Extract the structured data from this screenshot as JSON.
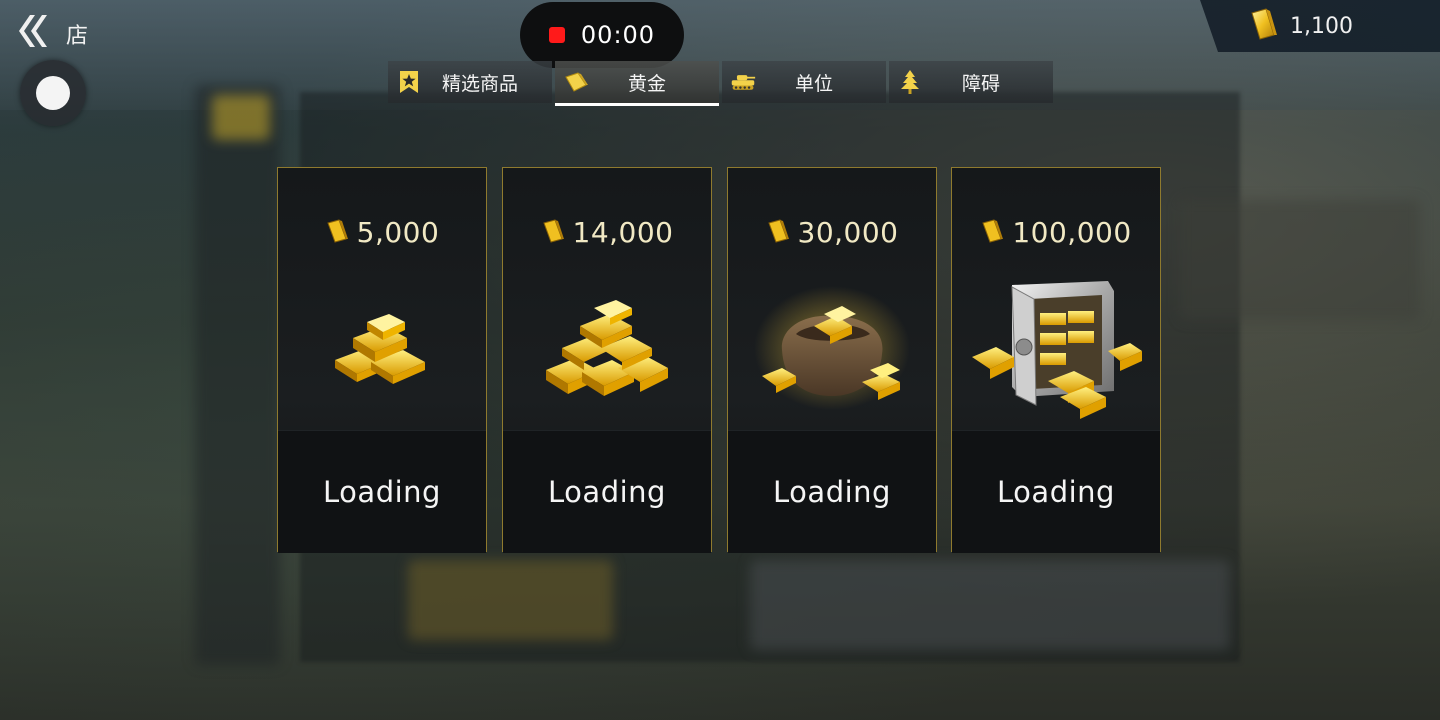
{
  "header": {
    "title": "店",
    "recording_time": "00:00",
    "currency_amount": "1,100"
  },
  "tabs": [
    {
      "label": "精选商品",
      "icon": "star-badge-icon",
      "active": false
    },
    {
      "label": "黄金",
      "icon": "gold-bar-icon",
      "active": true
    },
    {
      "label": "单位",
      "icon": "tank-icon",
      "active": false
    },
    {
      "label": "障碍",
      "icon": "tree-icon",
      "active": false
    }
  ],
  "products": [
    {
      "amount": "5,000",
      "art": "gold-bars-small-icon",
      "button": "Loading"
    },
    {
      "amount": "14,000",
      "art": "gold-bars-pile-icon",
      "button": "Loading"
    },
    {
      "amount": "30,000",
      "art": "gold-sack-icon",
      "button": "Loading"
    },
    {
      "amount": "100,000",
      "art": "gold-safe-icon",
      "button": "Loading"
    }
  ],
  "colors": {
    "gold": "#e8b820",
    "card_border": "#8f7a2e",
    "record_red": "#ff1a1a"
  }
}
